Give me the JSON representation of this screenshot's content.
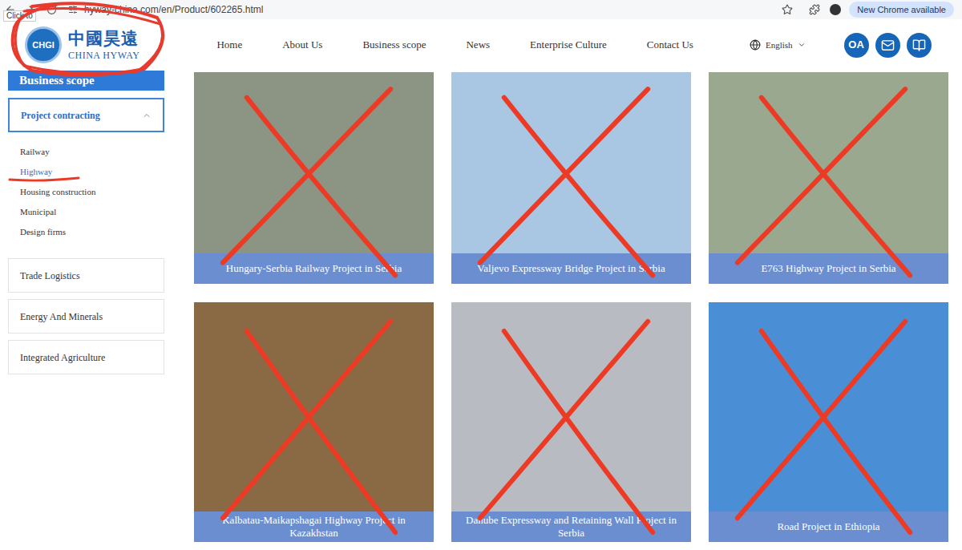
{
  "browser": {
    "tooltip": "Click to",
    "url": "hyway-china.com/en/Product/602265.html",
    "update_button": "New Chrome available"
  },
  "logo": {
    "emblem": "CHGI",
    "chinese": "中國昊遠",
    "english": "CHINA HYWAY",
    "circled": true
  },
  "nav": [
    "Home",
    "About Us",
    "Business scope",
    "News",
    "Enterprise Culture",
    "Contact Us"
  ],
  "language": "English",
  "header_buttons": [
    "OA"
  ],
  "sidebar": {
    "title": "Business scope",
    "groups": [
      {
        "label": "Project contracting",
        "expanded": true,
        "items": [
          {
            "label": "Railway",
            "selected": false,
            "underlined": false
          },
          {
            "label": "Highway",
            "selected": true,
            "underlined": true
          },
          {
            "label": "Housing construction",
            "selected": false,
            "underlined": false
          },
          {
            "label": "Municipal",
            "selected": false,
            "underlined": false
          },
          {
            "label": "Design firms",
            "selected": false,
            "underlined": false
          }
        ]
      },
      {
        "label": "Trade Logistics",
        "expanded": false,
        "items": []
      },
      {
        "label": "Energy And Minerals",
        "expanded": false,
        "items": []
      },
      {
        "label": "Integrated Agriculture",
        "expanded": false,
        "items": []
      }
    ]
  },
  "projects": [
    {
      "title": "Hungary-Serbia Railway Project in Serbia",
      "color": "#8c9484",
      "crossed_out": true
    },
    {
      "title": "Valjevo Expressway Bridge Project in Serbia",
      "color": "#a9c6e3",
      "crossed_out": true
    },
    {
      "title": "E763 Highway Project in Serbia",
      "color": "#9aa890",
      "crossed_out": true
    },
    {
      "title": "Kalbatau-Maikapshagai Highway Project in Kazakhstan",
      "color": "#8a6a45",
      "crossed_out": true
    },
    {
      "title": "Danube Expressway and Retaining Wall Project in Serbia",
      "color": "#b8bcc2",
      "crossed_out": true
    },
    {
      "title": "Road Project in Ethiopia",
      "color": "#4a8fd6",
      "crossed_out": true
    }
  ]
}
